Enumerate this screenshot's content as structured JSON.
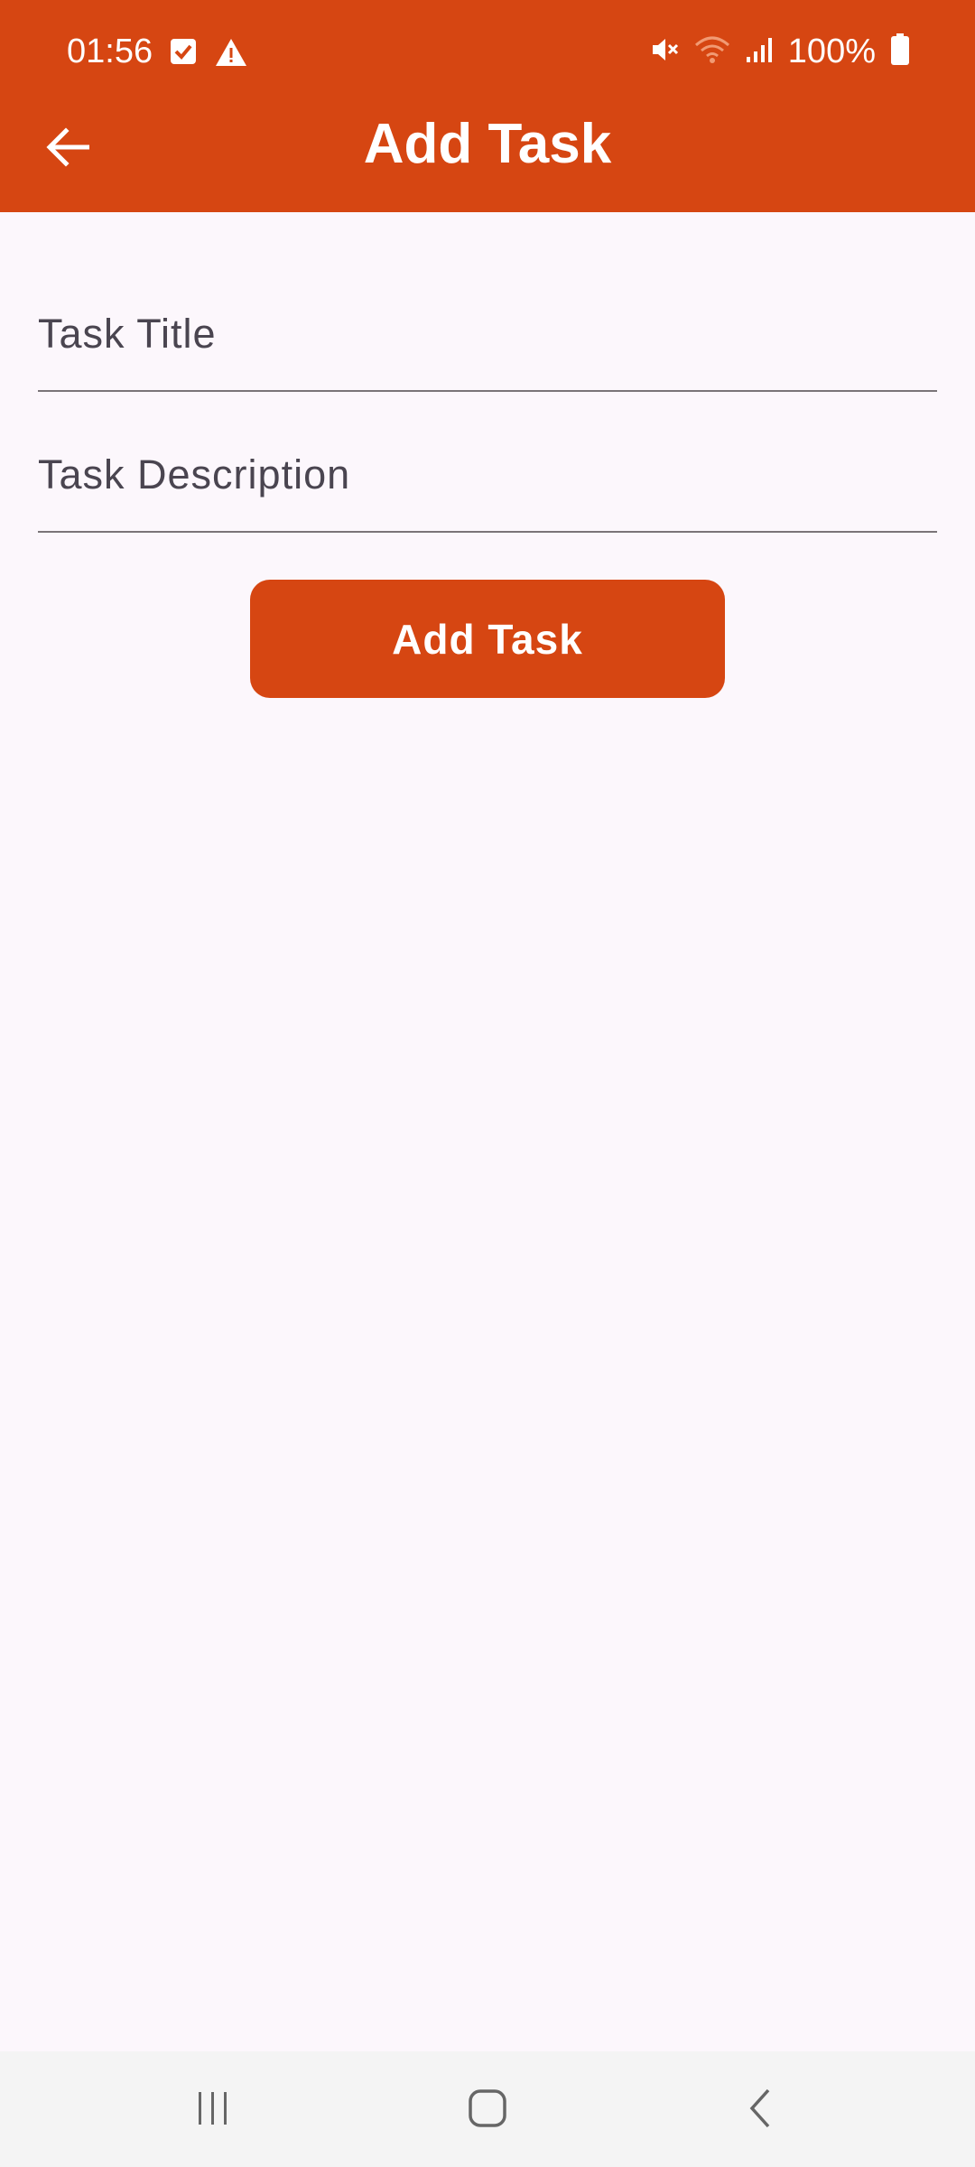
{
  "status_bar": {
    "time": "01:56",
    "battery": "100%",
    "icons": [
      "checkbox-icon",
      "warning-icon",
      "mute-icon",
      "wifi-icon",
      "signal-icon",
      "battery-icon"
    ]
  },
  "app_bar": {
    "title": "Add Task",
    "back_icon": "arrow-back-icon"
  },
  "form": {
    "title_field": {
      "placeholder": "Task Title",
      "value": ""
    },
    "description_field": {
      "placeholder": "Task Description",
      "value": ""
    },
    "submit_label": "Add Task"
  },
  "nav_bar": {
    "icons": [
      "recent-apps-icon",
      "home-icon",
      "back-icon"
    ]
  },
  "colors": {
    "primary": "#d64612",
    "background": "#fcf7fc",
    "text_muted": "#4a4550",
    "underline": "#7a7478"
  }
}
